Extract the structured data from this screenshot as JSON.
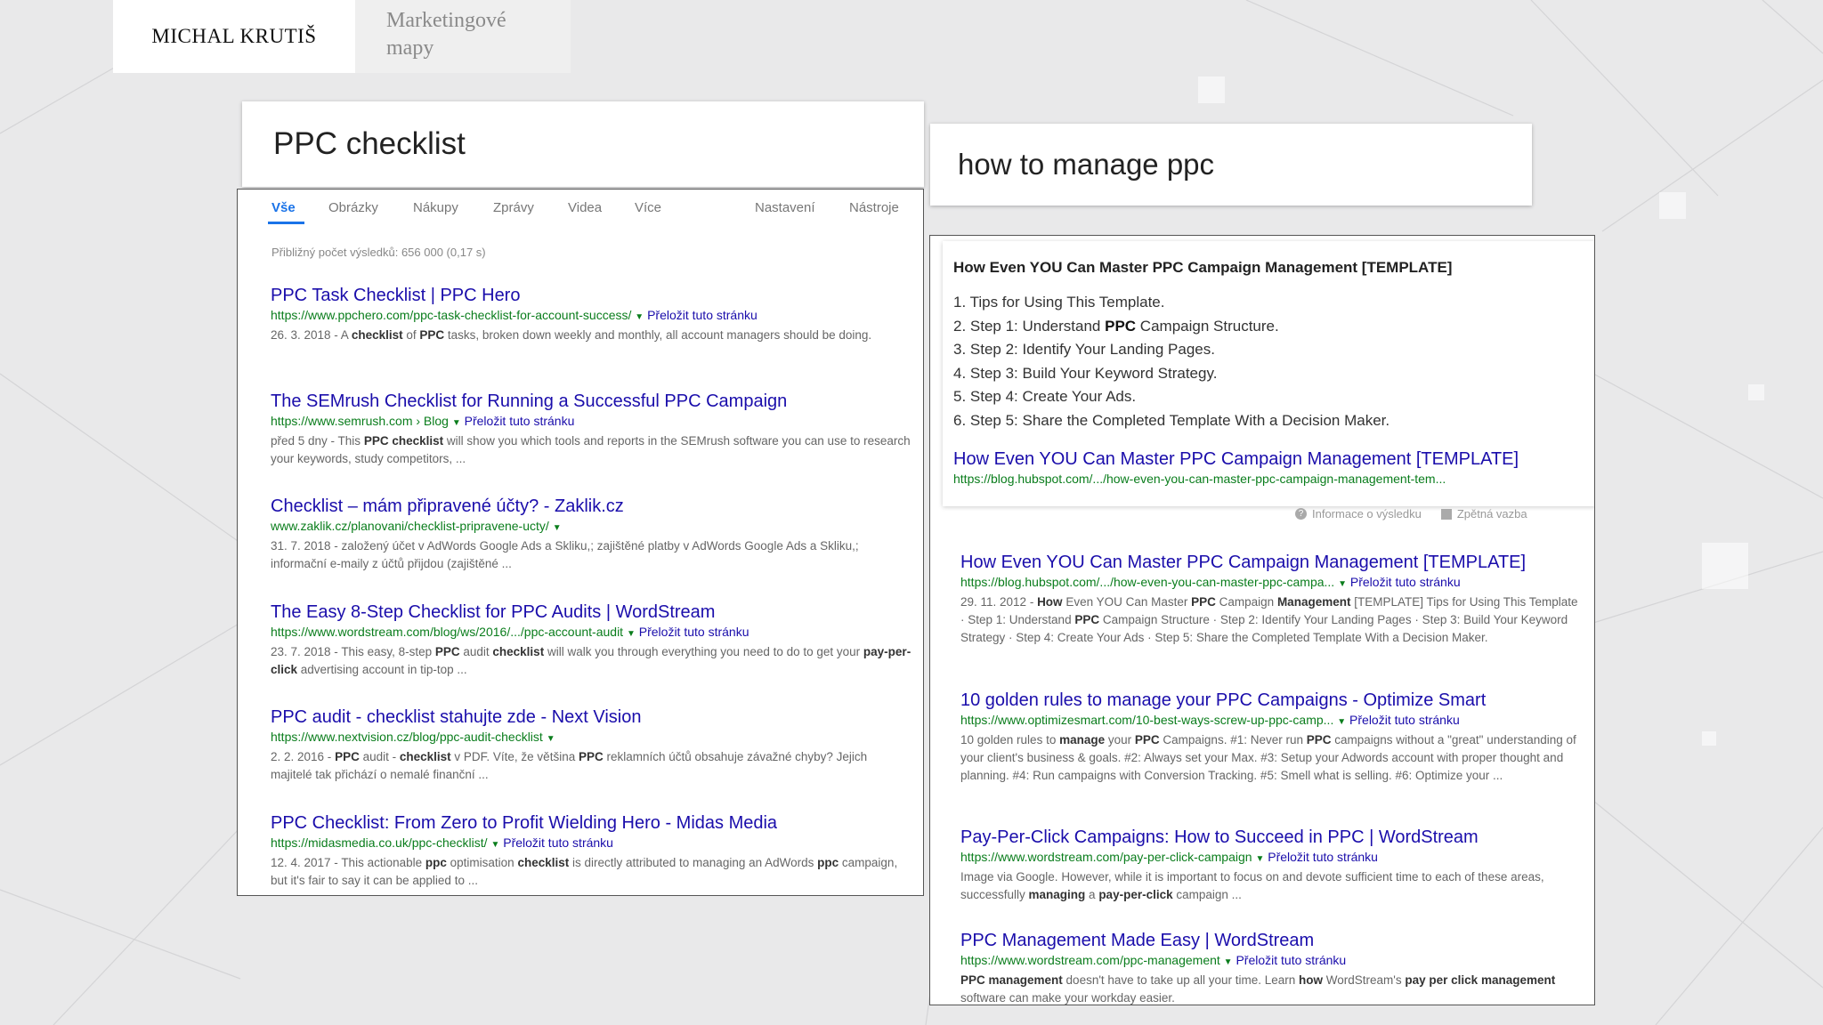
{
  "header": {
    "author": "MICHAL KRUTIŠ",
    "section": "Marketingové mapy"
  },
  "left": {
    "query": "PPC checklist",
    "tabs": [
      "Vše",
      "Obrázky",
      "Nákupy",
      "Zprávy",
      "Videa",
      "Více"
    ],
    "settings": [
      "Nastavení",
      "Nástroje"
    ],
    "stats": "Přibližný počet výsledků: 656 000 (0,17 s)",
    "results": [
      {
        "title": "PPC Task Checklist | PPC Hero",
        "url": "https://www.ppchero.com/ppc-task-checklist-for-account-success/",
        "translate": "Přeložit tuto stránku",
        "snippet_html": "26. 3. 2018 - A <b>checklist</b> of <b>PPC</b> tasks, broken down weekly and monthly, all account managers should be doing."
      },
      {
        "title": "The SEMrush Checklist for Running a Successful PPC Campaign",
        "url": "https://www.semrush.com › Blog",
        "translate": "Přeložit tuto stránku",
        "snippet_html": "před 5 dny - This <b>PPC checklist</b> will show you which tools and reports in the SEMrush software you can use to research your keywords, study competitors, ..."
      },
      {
        "title": "Checklist – mám připravené účty? - Zaklik.cz",
        "url": "www.zaklik.cz/planovani/checklist-pripravene-ucty/",
        "translate": "",
        "snippet_html": "31. 7. 2018 - založený účet v AdWords Google Ads a Skliku,; zajištěné platby v AdWords Google Ads a Skliku,; informační e-maily z účtů přijdou (zajištěné ..."
      },
      {
        "title": "The Easy 8-Step Checklist for PPC Audits | WordStream",
        "url": "https://www.wordstream.com/blog/ws/2016/.../ppc-account-audit",
        "translate": "Přeložit tuto stránku",
        "snippet_html": "23. 7. 2018 - This easy, 8-step <b>PPC</b> audit <b>checklist</b> will walk you through everything you need to do to get your <b>pay-per-click</b> advertising account in tip-top ..."
      },
      {
        "title": "PPC audit - checklist stahujte zde - Next Vision",
        "url": "https://www.nextvision.cz/blog/ppc-audit-checklist",
        "translate": "",
        "snippet_html": "2. 2. 2016 - <b>PPC</b> audit - <b>checklist</b> v PDF. Víte, že většina <b>PPC</b> reklamních účtů obsahuje závažné chyby? Jejich majitelé tak přichází o nemalé finanční ..."
      },
      {
        "title": "PPC Checklist: From Zero to Profit Wielding Hero - Midas Media",
        "url": "https://midasmedia.co.uk/ppc-checklist/",
        "translate": "Přeložit tuto stránku",
        "snippet_html": "12. 4. 2017 - This actionable <b>ppc</b> optimisation <b>checklist</b> is directly attributed to managing an AdWords <b>ppc</b> campaign, but it's fair to say it can be applied to ..."
      }
    ]
  },
  "right": {
    "query": "how to manage ppc",
    "snippet": {
      "title": "How Even YOU Can Master PPC Campaign Management [TEMPLATE]",
      "list_html": [
        "1. Tips for Using This Template.",
        "2. Step 1: Understand <b>PPC</b> Campaign Structure.",
        "3. Step 2: Identify Your Landing Pages.",
        "4. Step 3: Build Your Keyword Strategy.",
        "5. Step 4: Create Your Ads.",
        "6. Step 5: Share the Completed Template With a Decision Maker."
      ],
      "link": "How Even YOU Can Master PPC Campaign Management [TEMPLATE]",
      "url": "https://blog.hubspot.com/.../how-even-you-can-master-ppc-campaign-management-tem..."
    },
    "feedback": {
      "info": "Informace o výsledku",
      "feedback": "Zpětná vazba"
    },
    "results": [
      {
        "title": "How Even YOU Can Master PPC Campaign Management [TEMPLATE]",
        "url": "https://blog.hubspot.com/.../how-even-you-can-master-ppc-campa...",
        "translate": "Přeložit tuto stránku",
        "snippet_html": "29. 11. 2012 - <b>How</b> Even YOU Can Master <b>PPC</b> Campaign <b>Management</b> [TEMPLATE] Tips for Using This Template · Step 1: Understand <b>PPC</b> Campaign Structure · Step 2: Identify Your Landing Pages · Step 3: Build Your Keyword Strategy · Step 4: Create Your Ads · Step 5: Share the Completed Template With a Decision Maker."
      },
      {
        "title": "10 golden rules to manage your PPC Campaigns - Optimize Smart",
        "url": "https://www.optimizesmart.com/10-best-ways-screw-up-ppc-camp...",
        "translate": "Přeložit tuto stránku",
        "snippet_html": "10 golden rules to <b>manage</b> your <b>PPC</b> Campaigns. #1: Never run <b>PPC</b> campaigns without a \"great\" understanding of your client's business &amp; goals. #2: Always set your Max. #3: Setup your Adwords account with proper thought and planning. #4: Run campaigns with Conversion Tracking. #5: Smell what is selling. #6: Optimize your ..."
      },
      {
        "title": "Pay-Per-Click Campaigns: How to Succeed in PPC | WordStream",
        "url": "https://www.wordstream.com/pay-per-click-campaign",
        "translate": "Přeložit tuto stránku",
        "snippet_html": "Image via Google. However, while it is important to focus on and devote sufficient time to each of these areas, successfully <b>managing</b> a <b>pay-per-click</b> campaign ..."
      },
      {
        "title": "PPC Management Made Easy | WordStream",
        "url": "https://www.wordstream.com/ppc-management",
        "translate": "Přeložit tuto stránku",
        "snippet_html": "<b>PPC management</b> doesn't have to take up all your time. Learn <b>how</b> WordStream's <b>pay per click management</b> software can make your workday easier."
      }
    ]
  }
}
